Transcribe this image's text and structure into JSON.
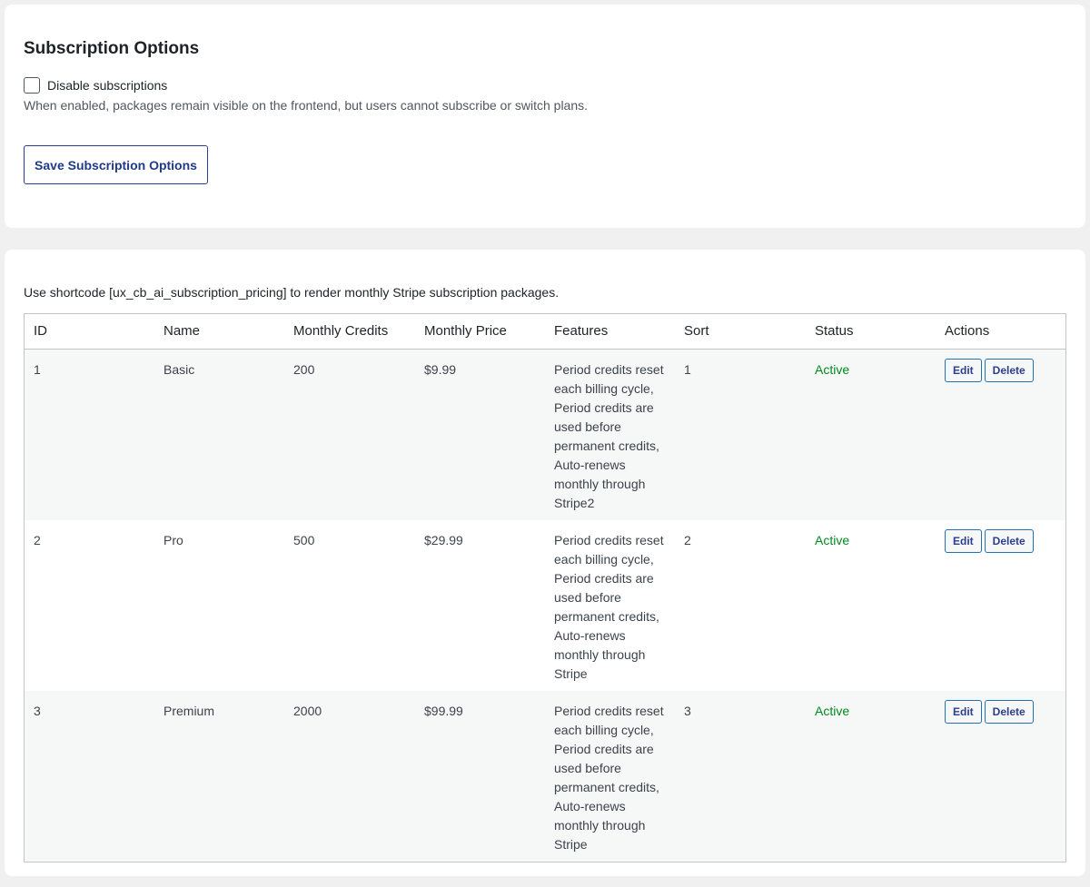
{
  "options": {
    "title": "Subscription Options",
    "disable_label": "Disable subscriptions",
    "disable_checked": false,
    "help_text": "When enabled, packages remain visible on the frontend, but users cannot subscribe or switch plans.",
    "save_label": "Save Subscription Options"
  },
  "packages": {
    "shortcode_note": "Use shortcode [ux_cb_ai_subscription_pricing] to render monthly Stripe subscription packages.",
    "columns": [
      "ID",
      "Name",
      "Monthly Credits",
      "Monthly Price",
      "Features",
      "Sort",
      "Status",
      "Actions"
    ],
    "rows": [
      {
        "id": "1",
        "name": "Basic",
        "credits": "200",
        "price": "$9.99",
        "features": "Period credits reset each billing cycle, Period credits are used before permanent credits, Auto-renews monthly through Stripe2",
        "sort": "1",
        "status": "Active",
        "edit_label": "Edit",
        "delete_label": "Delete"
      },
      {
        "id": "2",
        "name": "Pro",
        "credits": "500",
        "price": "$29.99",
        "features": "Period credits reset each billing cycle, Period credits are used before permanent credits, Auto-renews monthly through Stripe",
        "sort": "2",
        "status": "Active",
        "edit_label": "Edit",
        "delete_label": "Delete"
      },
      {
        "id": "3",
        "name": "Premium",
        "credits": "2000",
        "price": "$99.99",
        "features": "Period credits reset each billing cycle, Period credits are used before permanent credits, Auto-renews monthly through Stripe",
        "sort": "3",
        "status": "Active",
        "edit_label": "Edit",
        "delete_label": "Delete"
      }
    ]
  },
  "colors": {
    "status_active": "#008a20",
    "button_text": "#2c3e8f",
    "background": "#f0f0f1"
  }
}
